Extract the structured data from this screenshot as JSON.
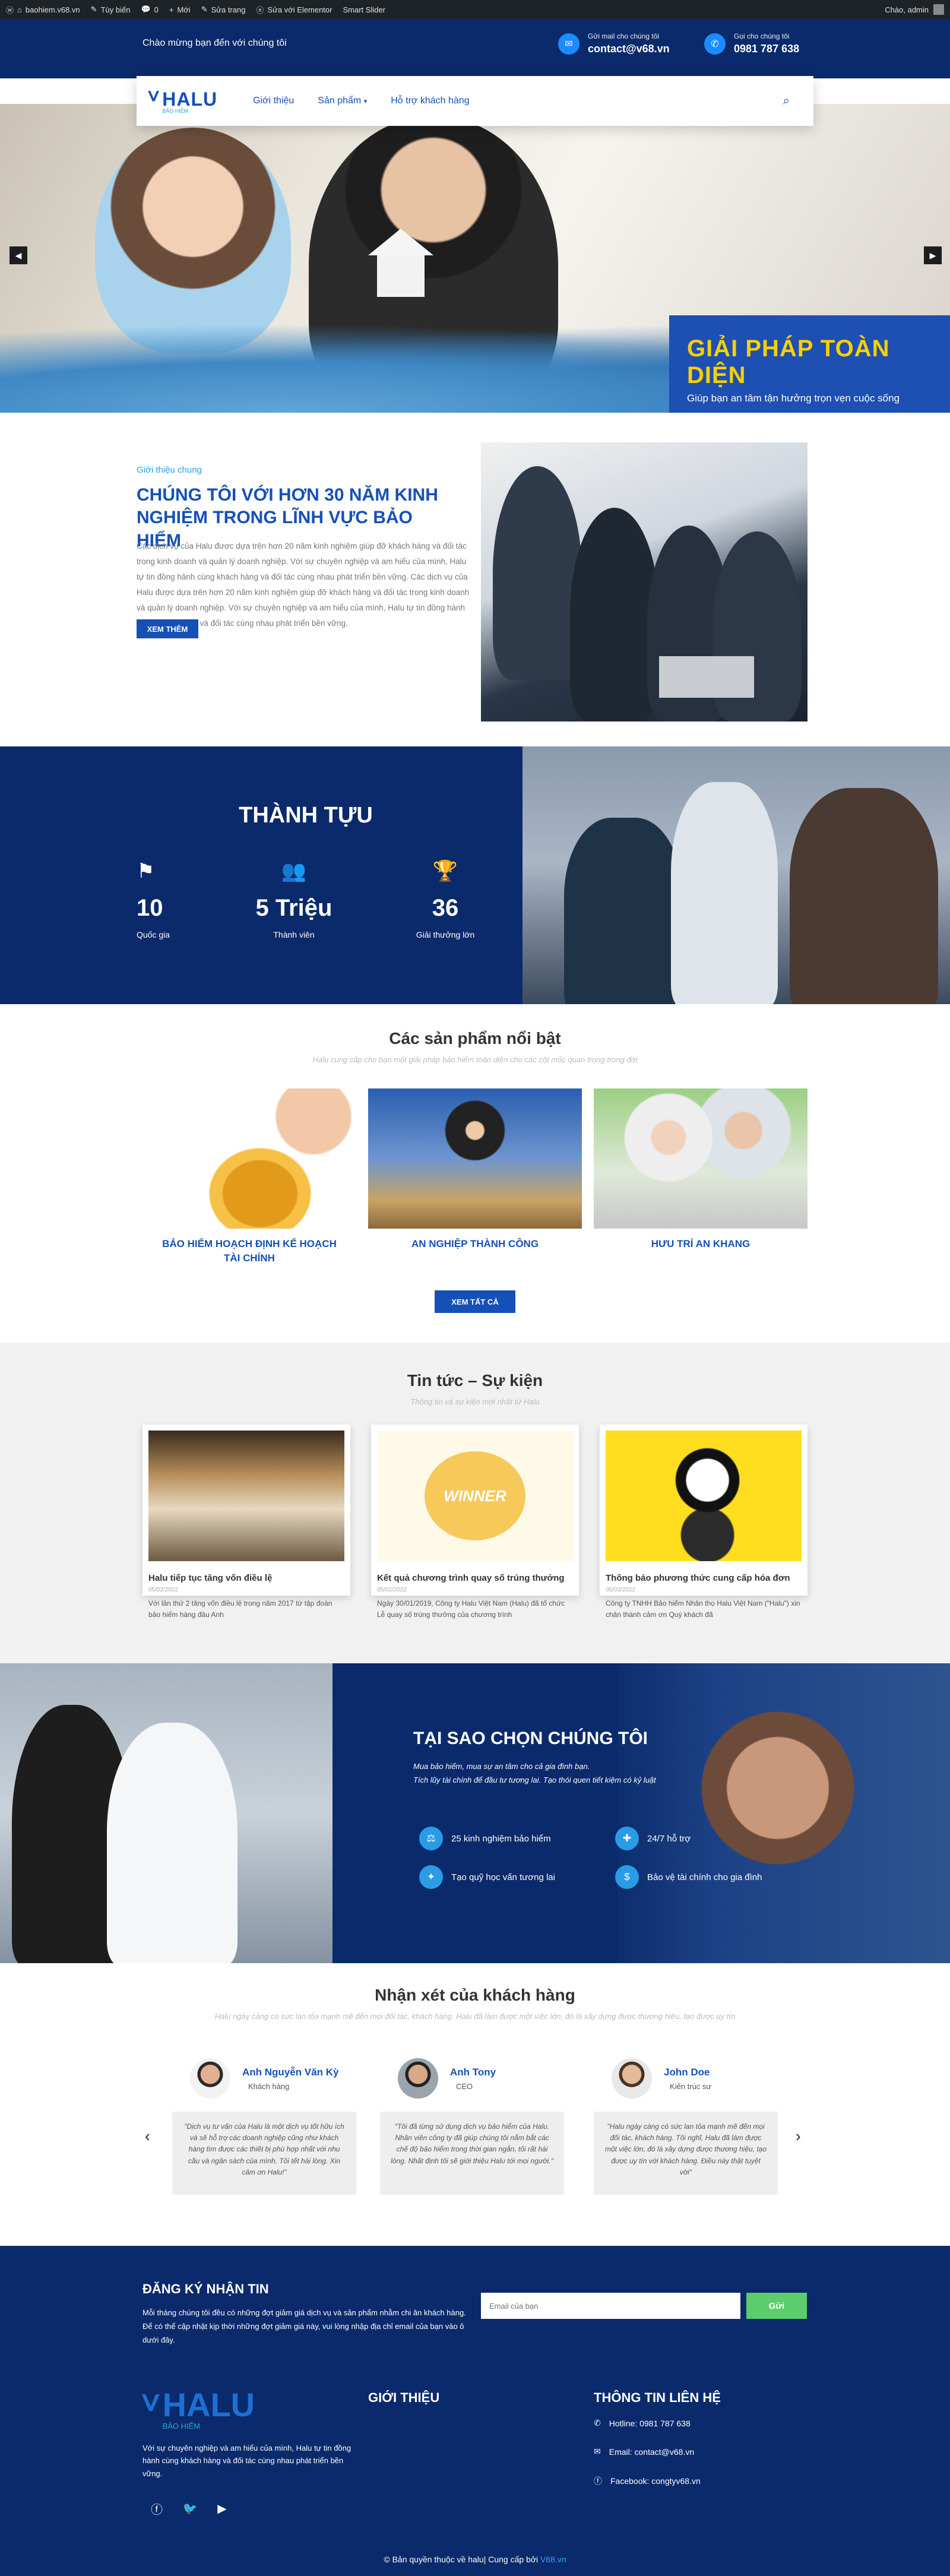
{
  "admin_bar": {
    "items": [
      "baohiem.v68.vn",
      "Tùy biến",
      "0",
      "Mới",
      "Sửa trang",
      "Sửa với Elementor",
      "Smart Slider"
    ],
    "greeting": "Chào, admin"
  },
  "topbar": {
    "welcome": "Chào mừng bạn đến với chúng tôi",
    "email_label": "Gửi mail cho chúng tôi",
    "email_value": "contact@v68.vn",
    "phone_label": "Gọi cho chúng tôi",
    "phone_value": "0981 787 638"
  },
  "nav": {
    "logo_word": "HALU",
    "logo_sub": "BẢO HIỂM",
    "links": [
      "Giới thiệu",
      "Sản phẩm",
      "Hỗ trợ khách hàng"
    ]
  },
  "hero": {
    "title": "GIẢI PHÁP TOÀN DIỆN",
    "subtitle": "Giúp bạn an tâm tận hưởng trọn vẹn cuộc sống"
  },
  "intro": {
    "label": "Giới thiệu chung",
    "heading": "CHÚNG TÔI VỚI HƠN 30 NĂM KINH NGHIỆM TRONG LĨNH VỰC BẢO HIỂM",
    "body": "Các dịch vụ của Halu được dựa trên hơn 20 năm kinh nghiệm giúp đỡ khách hàng và đối tác trong kinh doanh và quản lý doanh nghiệp. Với sự chuyên nghiệp và am hiểu của mình, Halu tự tin đồng hành cùng khách hàng và đối tác cùng nhau phát triển bền vững. Các dịch vụ của Halu được dựa trên hơn 20 năm kinh nghiệm giúp đỡ khách hàng và đối tác trong kinh doanh và quản lý doanh nghiệp. Với sự chuyên nghiệp và am hiểu của mình, Halu tự tin đồng hành cùng khách hàng và đối tác cùng nhau phát triển bền vững.",
    "button": "XEM THÊM"
  },
  "achievements": {
    "title": "THÀNH TỰU",
    "stats": [
      {
        "num": "10",
        "cap": "Quốc gia"
      },
      {
        "num": "5 Triệu",
        "cap": "Thành viên"
      },
      {
        "num": "36",
        "cap": "Giải thưởng lớn"
      }
    ]
  },
  "products": {
    "title": "Các sản phẩm nổi bật",
    "subtitle": "Halu cung cấp cho bạn một giải pháp bảo hiểm toàn diện cho các cột mốc quan trọng trong đời",
    "items": [
      "BẢO HIỂM HOẠCH ĐỊNH KẾ HOẠCH TÀI CHÍNH",
      "AN NGHIỆP THÀNH CÔNG",
      "HƯU TRÍ AN KHANG"
    ],
    "button": "XEM TẤT CẢ"
  },
  "news": {
    "title": "Tin tức – Sự kiện",
    "subtitle": "Thông tin và sự kiện mới nhất từ Halu",
    "cards": [
      {
        "title": "Halu tiếp tục tăng vốn điều lệ",
        "date": "05/02/2022",
        "excerpt": "Với lần thứ 2 tăng vốn điều lệ trong năm 2017 từ tập đoàn bảo hiểm hàng đầu Anh"
      },
      {
        "title": "Kết quả chương trình quay số trúng thưởng",
        "date": "05/02/2022",
        "excerpt": "Ngày 30/01/2019, Công ty Halu Việt Nam (Halu) đã tổ chức Lễ quay số trúng thưởng của chương trình"
      },
      {
        "title": "Thông báo phương thức cung cấp hóa đơn",
        "date": "05/02/2022",
        "excerpt": "Công ty TNHH Bảo hiểm Nhân thọ Halu Việt Nam (\"Halu\") xin chân thành cảm ơn Quý khách đã"
      }
    ],
    "winner_text": "WINNER"
  },
  "why": {
    "title": "TẠI SAO CHỌN CHÚNG TÔI",
    "desc1": "Mua bảo hiểm, mua sự an tâm cho cả gia đình bạn.",
    "desc2": "Tích lũy tài chính để đầu tư tương lai. Tạo thói quen tiết kiệm có kỷ luật",
    "features": [
      "25 kinh nghiệm bảo hiểm",
      "24/7 hỗ trợ",
      "Tạo quỹ học vấn tương lai",
      "Bảo vệ tài chính cho gia đình"
    ]
  },
  "reviews": {
    "title": "Nhận xét của khách hàng",
    "subtitle": "Halu ngày càng có sức lan tỏa mạnh mẽ đến mọi đối tác, khách hàng. Halu đã làm được một việc lớn, đó là xây dựng được thương hiệu, tạo được uy tín",
    "items": [
      {
        "name": "Anh Nguyễn Văn Kỳ",
        "role": "Khách hàng",
        "quote": "\"Dịch vụ tư vấn của Halu là một dịch vụ tốt hữu ích và sẽ hỗ trợ các doanh nghiệp cũng như khách hàng tìm được các thiết bị phù hợp nhất với nhu cầu và ngân sách của mình. Tôi tết hài lòng. Xin cảm ơn Halu!\""
      },
      {
        "name": "Anh Tony",
        "role": "CEO",
        "quote": "\"Tôi đã từng sử dụng dịch vụ bảo hiểm của Halu. Nhân viên công ty đã giúp chúng tôi nắm bắt các chế độ bảo hiểm trong thời gian ngắn, tôi rất hài lòng. Nhất định tôi sẽ giới thiệu Halu tới mọi người.\""
      },
      {
        "name": "John Doe",
        "role": "Kiến trúc sư",
        "quote": "\"Halu ngày càng có sức lan tỏa mạnh mẽ đến mọi đối tác, khách hàng. Tôi nghĩ, Halu đã làm được một việc lớn, đó là xây dựng được thương hiệu, tạo được uy tín với khách hàng. Điều này thật tuyệt vời\""
      }
    ]
  },
  "footer": {
    "newsletter_title": "ĐĂNG KÝ NHẬN TIN",
    "newsletter_text": "Mỗi tháng chúng tôi đều có những đợt giảm giá dịch vụ và sản phẩm nhằm chi ân khách hàng. Để có thể cập nhật kịp thời những đợt giảm giá này, vui lòng nhập địa chỉ email của bạn vào ô dưới đây.",
    "email_placeholder": "Email của bạn",
    "send_button": "Gửi",
    "logo_word": "HALU",
    "logo_sub": "BẢO HIỂM",
    "about_text": "Với sự chuyên nghiệp và am hiểu của mình, Halu tự tin đồng hành cùng khách hàng và đối tác cùng nhau phát triển bền vững.",
    "col2_title": "GIỚI THIỆU",
    "col3_title": "THÔNG TIN LIÊN HỆ",
    "hotline": "Hotline: 0981 787 638",
    "email": "Email: contact@v68.vn",
    "facebook": "Facebook: congtyv68.vn",
    "copyright": "© Bản quyền thuộc về halu| Cung cấp bởi",
    "copyright_link": "V68.vn"
  }
}
